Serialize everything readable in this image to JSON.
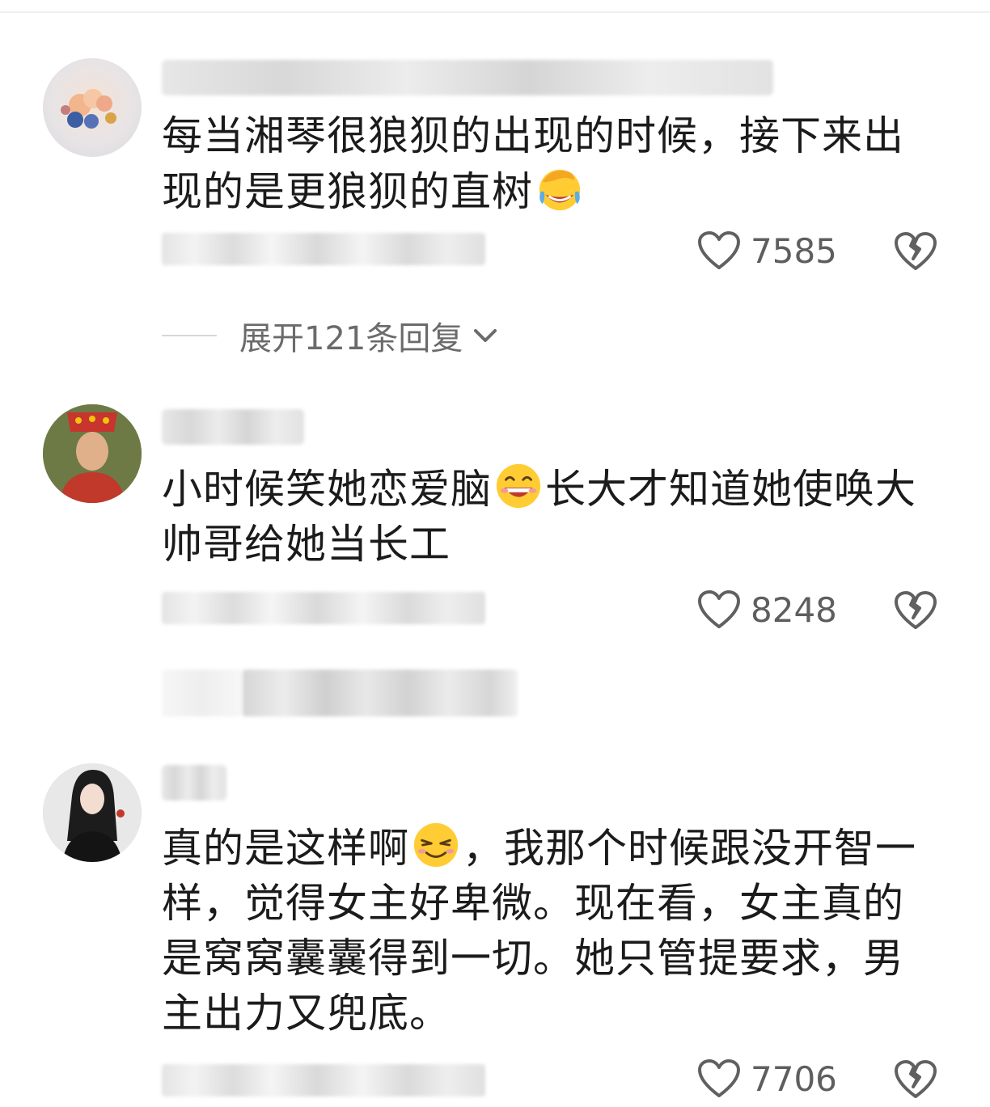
{
  "comments": [
    {
      "text_before_emoji": "每当湘琴很狼狈的出现的时候，接下来出现的是更狼狈的直树",
      "text_after_emoji": "",
      "emoji": "facepalm-laugh-emoji",
      "likes": "7585"
    },
    {
      "text_before_emoji": "小时候笑她恋爱脑",
      "text_after_emoji": "长大才知道她使唤大帅哥给她当长工",
      "emoji": "grin-emoji",
      "likes": "8248"
    },
    {
      "text_before_emoji": "真的是这样啊",
      "text_after_emoji": "，我那个时候跟没开智一样，觉得女主好卑微。现在看，女主真的是窝窝囊囊得到一切。她只管提要求，男主出力又兜底。",
      "emoji": "smug-smile-emoji",
      "likes": "7706"
    }
  ],
  "expand_replies": {
    "label": "展开121条回复"
  },
  "icons": {
    "like": "heart-outline-icon",
    "dislike": "broken-heart-icon",
    "expand": "chevron-down-icon"
  },
  "colors": {
    "text": "#1b1b1b",
    "muted": "#6b6b6b",
    "icon": "#606060"
  }
}
